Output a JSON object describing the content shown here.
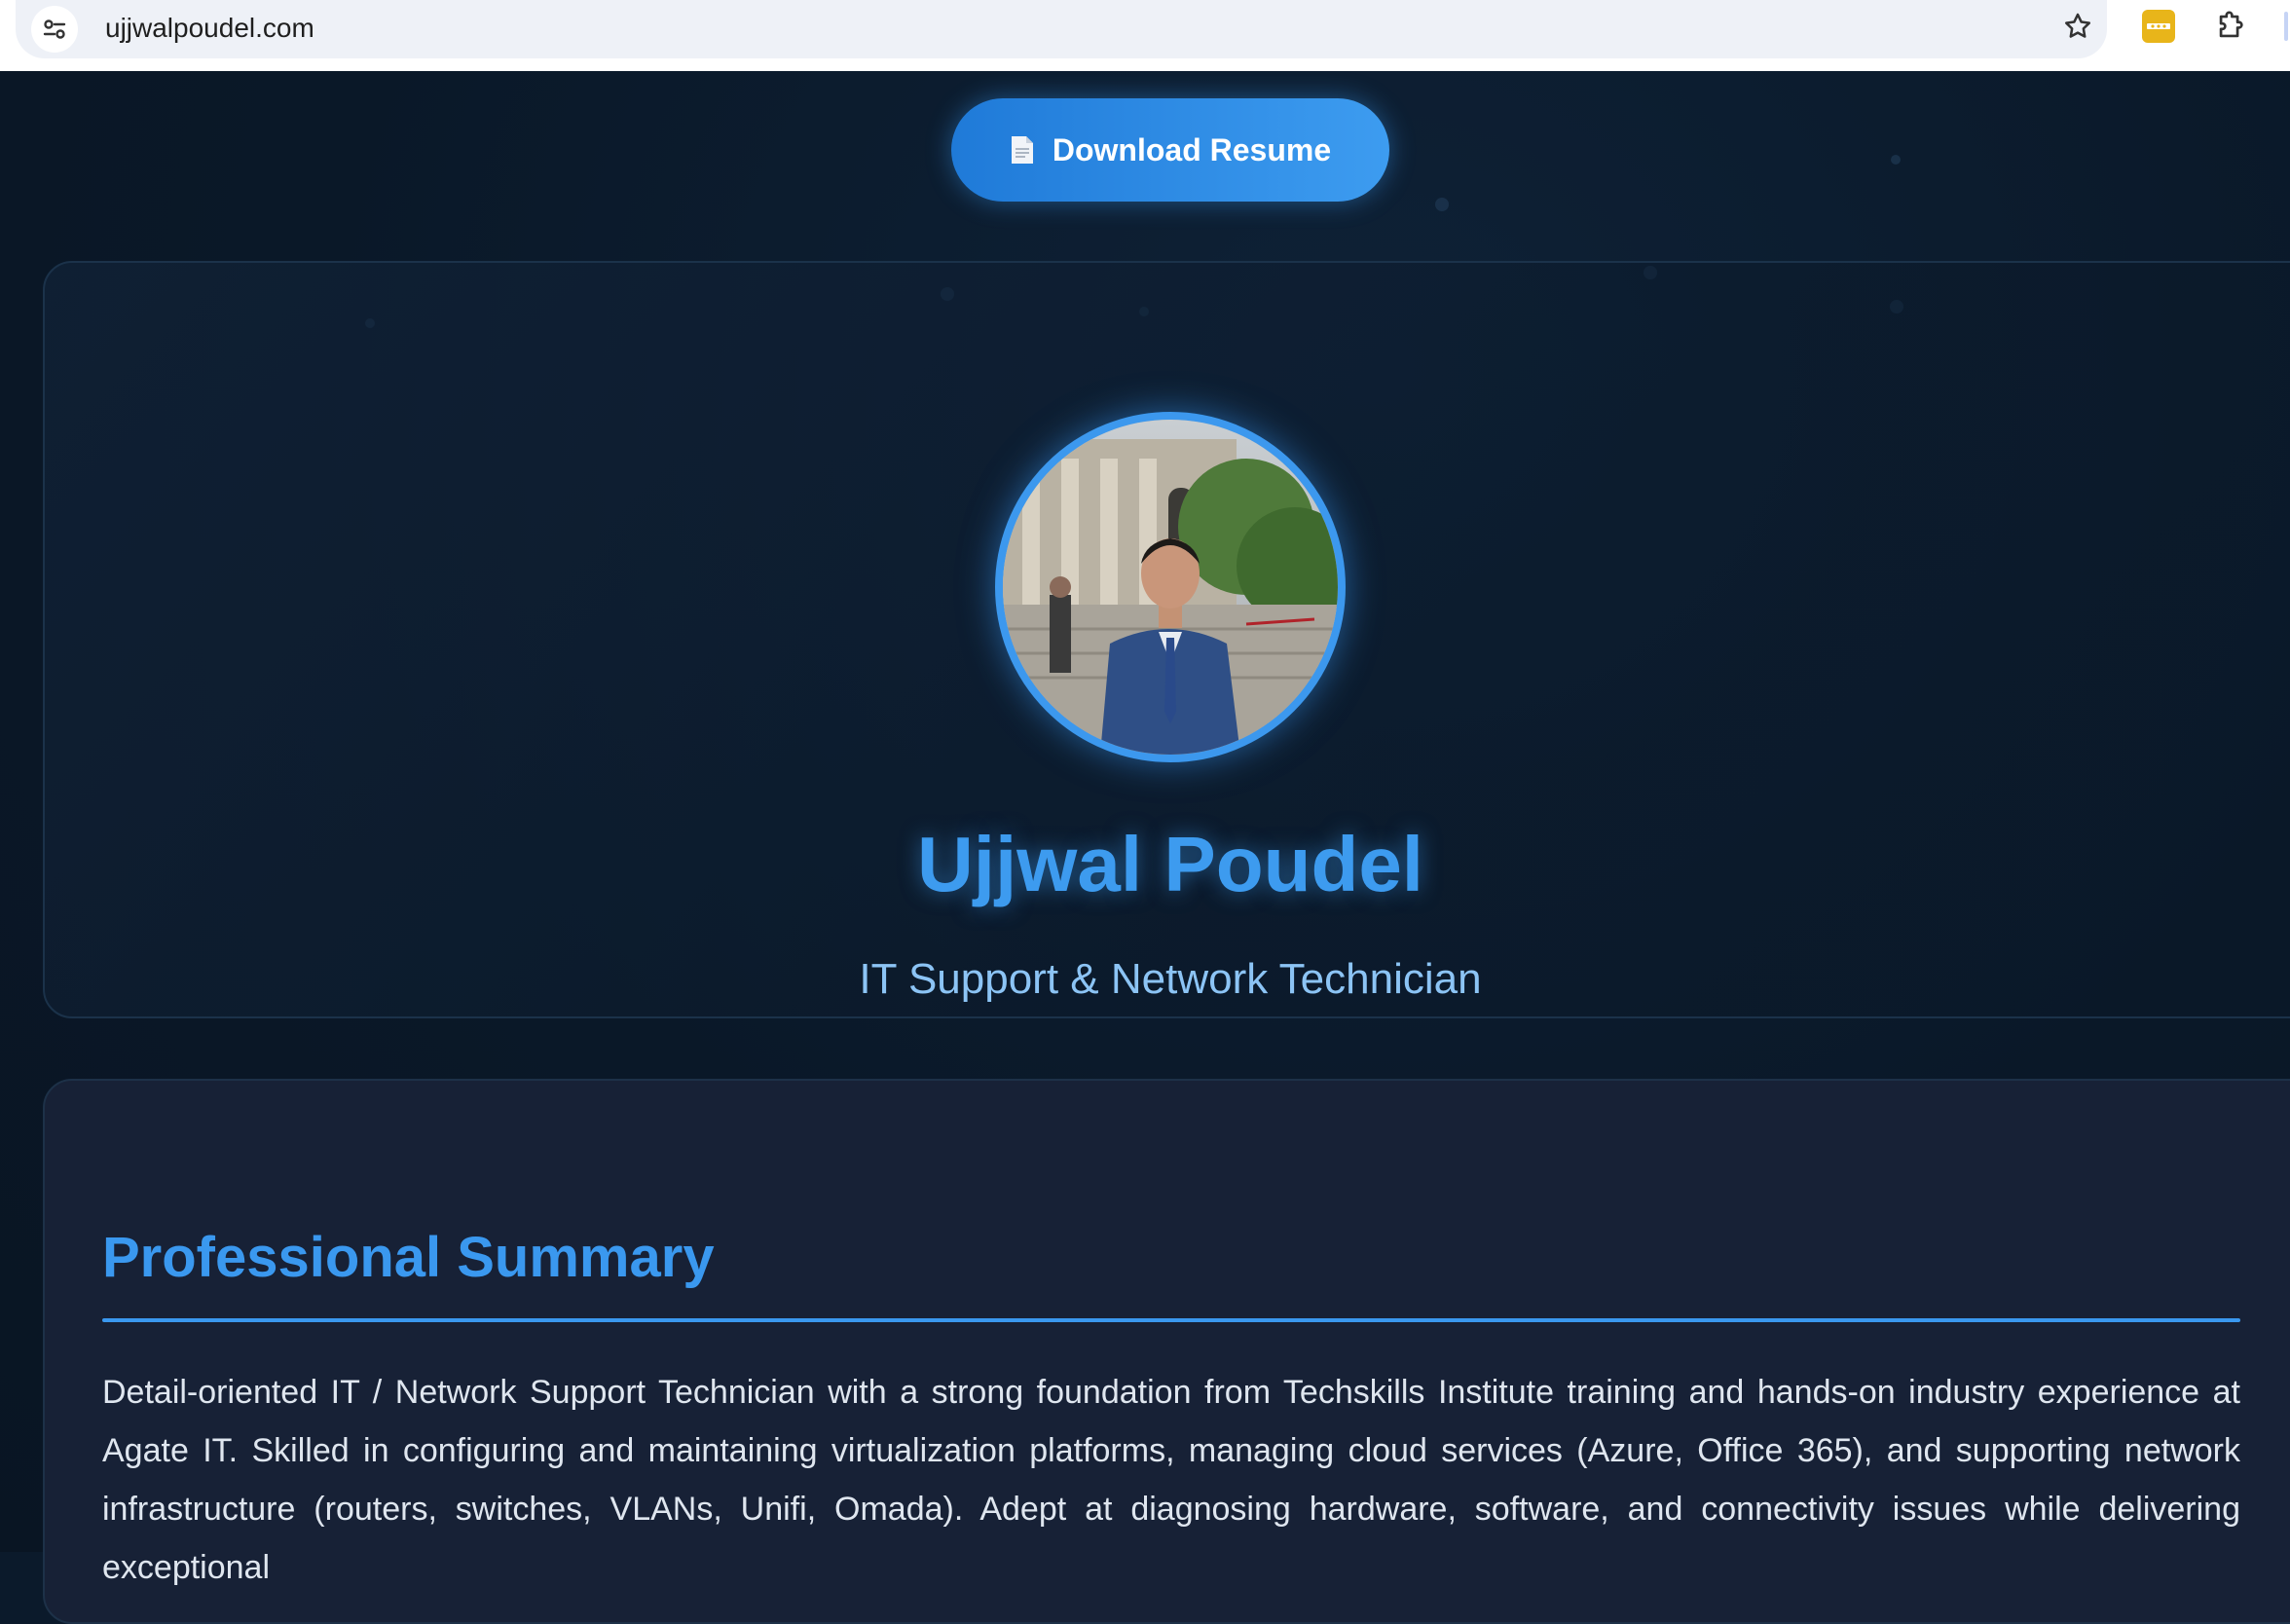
{
  "browser": {
    "url": "ujjwalpoudel.com",
    "icons": [
      "site-info-icon",
      "bookmark-star-icon",
      "extension-yellow-icon",
      "extensions-puzzle-icon"
    ]
  },
  "hero": {
    "download_label": "Download Resume",
    "download_icon": "document-icon",
    "name": "Ujjwal Poudel",
    "subtitle": "IT Support & Network Technician"
  },
  "summary": {
    "title": "Professional Summary",
    "text": "Detail-oriented IT / Network Support Technician with a strong foundation from Techskills Institute training and hands-on industry experience at Agate IT. Skilled in configuring and maintaining virtualization platforms, managing cloud services (Azure, Office 365), and supporting network infrastructure (routers, switches, VLANs, Unifi, Omada). Adept at diagnosing hardware, software, and connectivity issues while delivering exceptional"
  },
  "colors": {
    "accent": "#3d9bef",
    "page_bg": "#0b1a2b",
    "card_bg": "#172136",
    "subtitle": "#8cc4f5"
  }
}
